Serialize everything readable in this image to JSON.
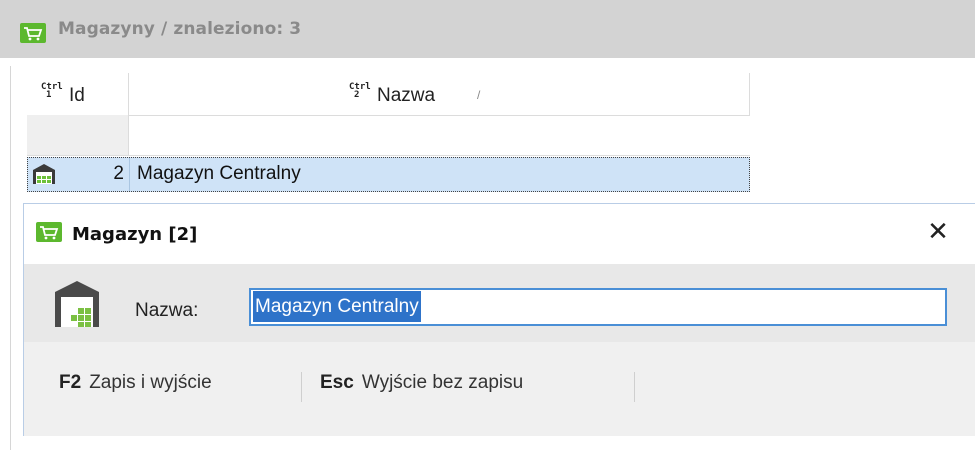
{
  "list": {
    "title": "Magazyny / znaleziono: 3",
    "columns": [
      {
        "ctrl_label": "Ctrl",
        "ctrl_number": "1",
        "label": "Id"
      },
      {
        "ctrl_label": "Ctrl",
        "ctrl_number": "2",
        "label": "Nazwa",
        "sort_indicator": "/"
      }
    ],
    "rows": [
      {
        "id": "2",
        "name": "Magazyn Centralny",
        "icon": "warehouse-icon"
      }
    ]
  },
  "dialog": {
    "title": "Magazyn [2]",
    "close_glyph": "✕",
    "field_label": "Nazwa:",
    "field_value": "Magazyn Centralny",
    "actions": [
      {
        "key": "F2",
        "label": "Zapis i wyjście"
      },
      {
        "key": "Esc",
        "label": "Wyjście bez zapisu"
      }
    ]
  },
  "colors": {
    "accent_green": "#5cb82e",
    "selection_blue": "#2e73c9",
    "row_highlight": "#cfe3f7"
  }
}
